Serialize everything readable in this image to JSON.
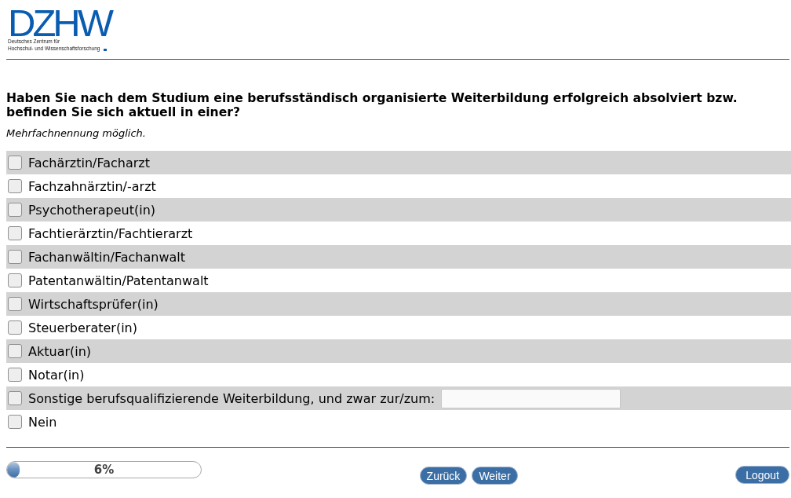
{
  "logo": {
    "wordmark": "DZHW",
    "subtitle_lines": [
      "Deutsches Zentrum für",
      "Hochschul- und Wissenschaftsforschung"
    ]
  },
  "question": {
    "text": "Haben Sie nach dem Studium eine berufsständisch organisierte Weiterbildung erfolgreich absolviert bzw. befinden Sie sich aktuell in einer?",
    "hint": "Mehrfachnennung möglich."
  },
  "options": [
    {
      "kind": "plain",
      "label": "Fachärztin/Facharzt",
      "checked": false
    },
    {
      "kind": "plain",
      "label": "Fachzahnärztin/-arzt",
      "checked": false
    },
    {
      "kind": "plain",
      "label": "Psychotherapeut(in)",
      "checked": false
    },
    {
      "kind": "plain",
      "label": "Fachtierärztin/Fachtierarzt",
      "checked": false
    },
    {
      "kind": "plain",
      "label": "Fachanwältin/Fachanwalt",
      "checked": false
    },
    {
      "kind": "plain",
      "label": "Patentanwältin/Patentanwalt",
      "checked": false
    },
    {
      "kind": "plain",
      "label": "Wirtschaftsprüfer(in)",
      "checked": false
    },
    {
      "kind": "plain",
      "label": "Steuerberater(in)",
      "checked": false
    },
    {
      "kind": "plain",
      "label": "Aktuar(in)",
      "checked": false
    },
    {
      "kind": "plain",
      "label": "Notar(in)",
      "checked": false
    },
    {
      "kind": "with_text",
      "label": "Sonstige berufsqualifizierende Weiterbildung, und zwar zur/zum:",
      "checked": false
    },
    {
      "kind": "plain",
      "label": "Nein",
      "checked": false
    }
  ],
  "progress": {
    "level": 0.06,
    "label": "6%"
  },
  "navigation": {
    "buttons": [
      "Zurück",
      "Weiter"
    ]
  },
  "logout": "Logout"
}
